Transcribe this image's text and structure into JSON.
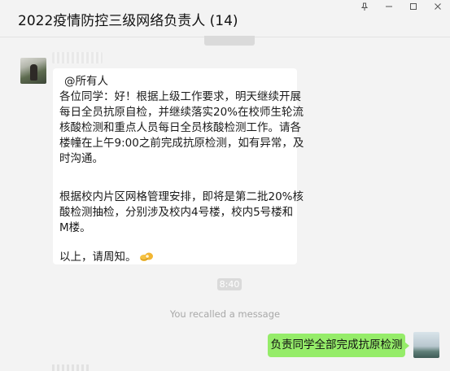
{
  "window": {
    "title": "2022疫情防控三级网络负责人 (14)",
    "controls": [
      "pin-icon",
      "minimize-icon",
      "maximize-icon",
      "close-icon"
    ]
  },
  "messages": [
    {
      "type": "incoming",
      "lines": [
        "@所有人",
        "各位同学：好！根据上级工作要求，明天继续开展",
        "每日全员抗原自检，并继续落实20%在校师生轮流",
        "核酸检测和重点人员每日全员核酸检测工作。请各",
        "楼幢在上午9:00之前完成抗原检测，如有异常，及",
        "时沟通。",
        "根据校内片区网格管理安排，即将是第二批20%核",
        "酸检测抽检，分别涉及校内4号楼，校内5号楼和",
        "M楼。",
        "以上，请周知。"
      ],
      "emoji": "ok-hand-emoji"
    },
    {
      "type": "time",
      "text": "8:40"
    },
    {
      "type": "system",
      "text": "You recalled a message"
    },
    {
      "type": "outgoing",
      "text": "负责同学全部完成抗原检测"
    }
  ],
  "colors": {
    "background": "#f3f3f3",
    "incoming_bubble": "#ffffff",
    "outgoing_bubble": "#95ec69",
    "system_text": "#a8a8a8",
    "time_chip": "#dadada"
  }
}
